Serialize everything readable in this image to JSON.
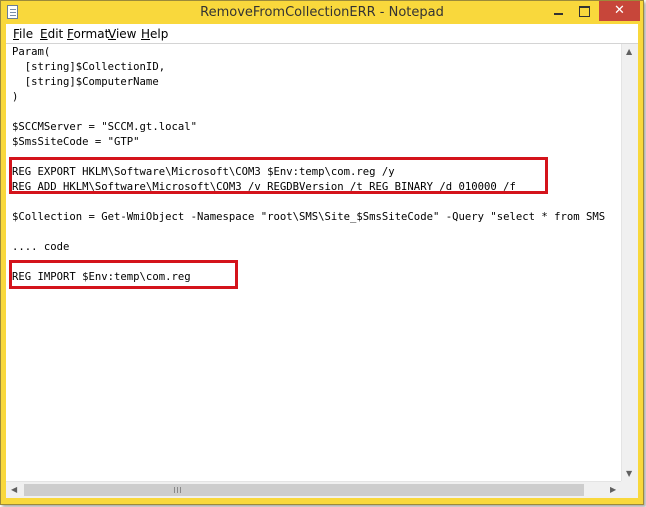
{
  "window": {
    "title": "RemoveFromCollectionERR - Notepad",
    "close_glyph": "✕",
    "accent": "#f9d83c",
    "close_color": "#c7463a"
  },
  "menu": [
    "File",
    "Edit",
    "Format",
    "View",
    "Help"
  ],
  "editor": {
    "lines": [
      "Param(",
      "  [string]$CollectionID,",
      "  [string]$ComputerName",
      ")",
      "",
      "$SCCMServer = \"SCCM.gt.local\"",
      "$SmsSiteCode = \"GTP\"",
      "",
      "REG EXPORT HKLM\\Software\\Microsoft\\COM3 $Env:temp\\com.reg /y",
      "REG ADD HKLM\\Software\\Microsoft\\COM3 /v REGDBVersion /t REG_BINARY /d 010000 /f",
      "",
      "$Collection = Get-WmiObject -Namespace \"root\\SMS\\Site_$SmsSiteCode\" -Query \"select * from SMS",
      "",
      ".... code",
      "",
      "REG IMPORT $Env:temp\\com.reg"
    ],
    "highlight_color": "#d4131b"
  },
  "icons": {
    "app": "notepad-icon",
    "minimize": "minimize-icon",
    "maximize": "maximize-icon",
    "close": "close-icon"
  }
}
